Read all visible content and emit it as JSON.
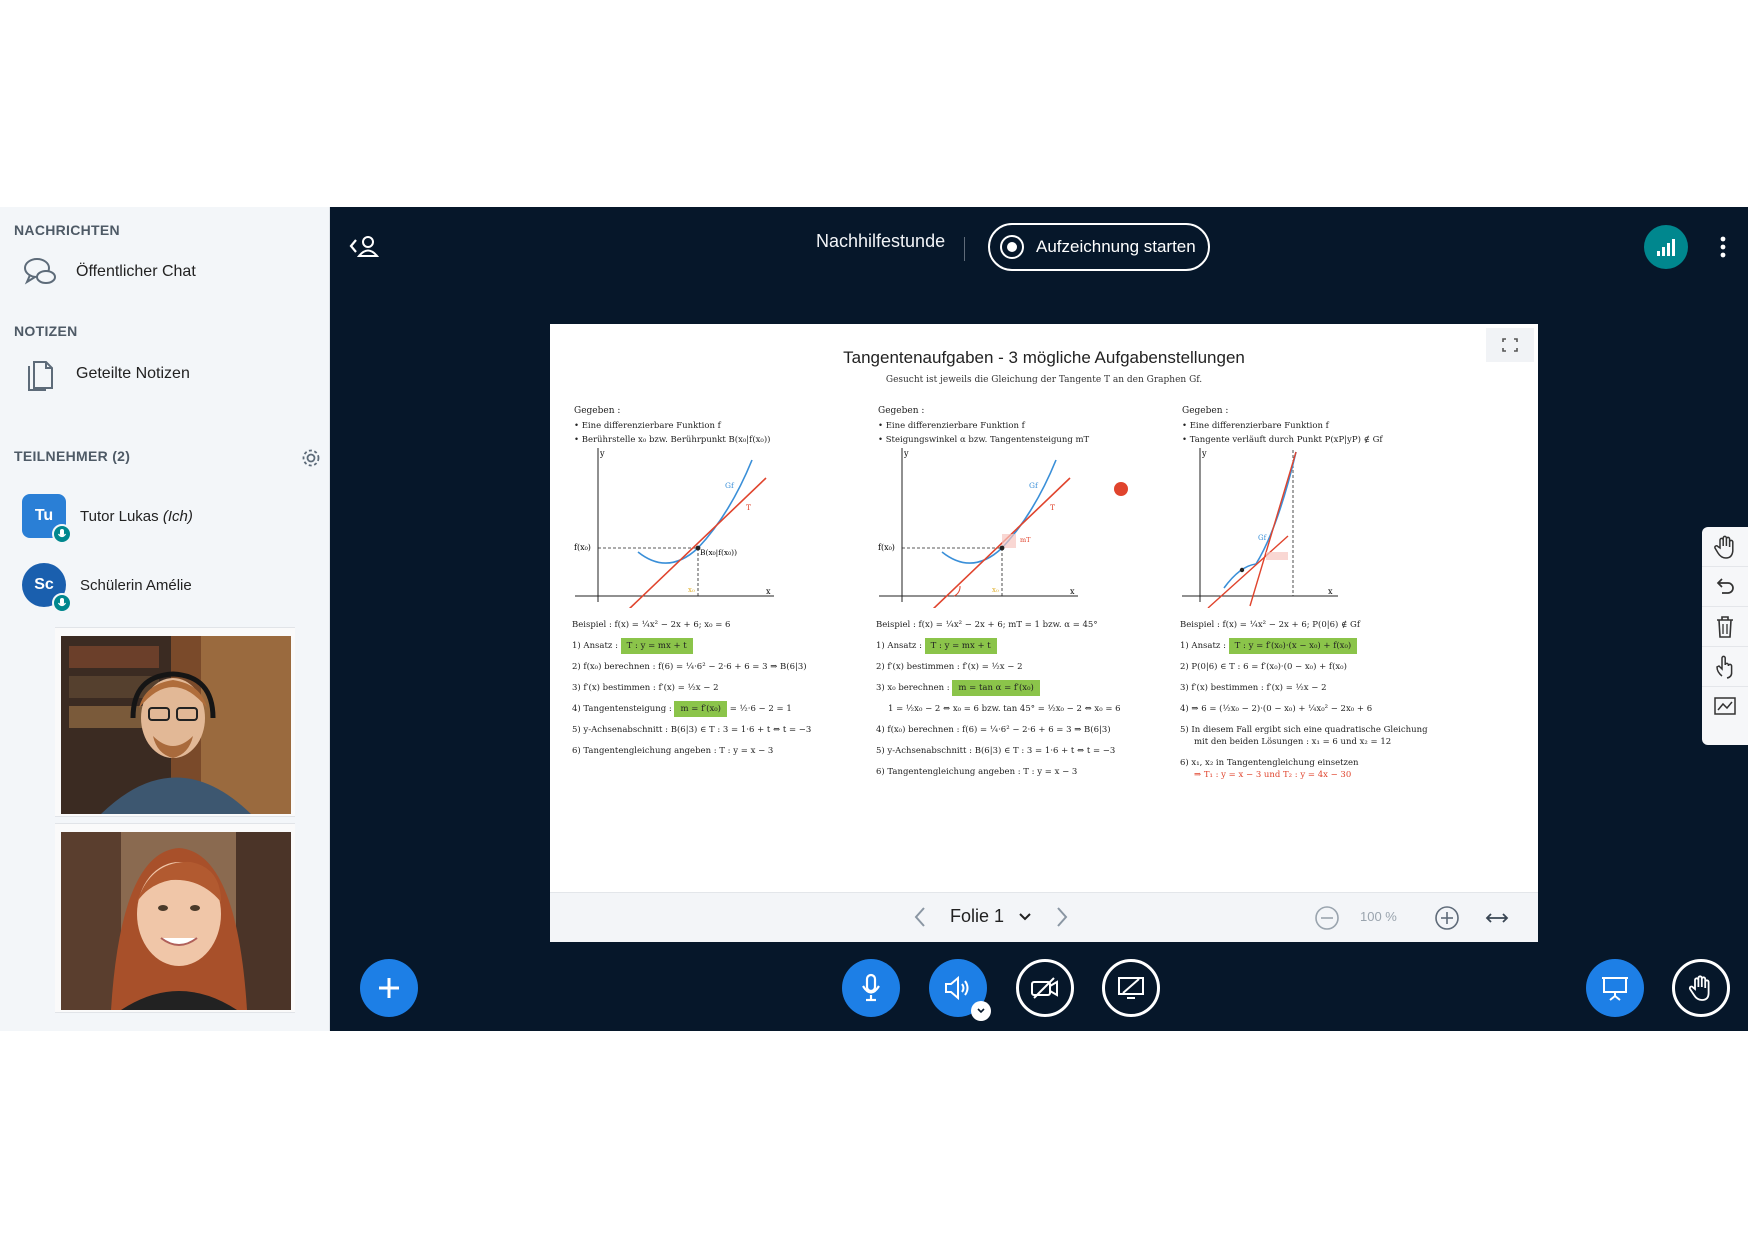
{
  "sidebar": {
    "messages_title": "NACHRICHTEN",
    "public_chat": "Öffentlicher Chat",
    "notes_title": "NOTIZEN",
    "shared_notes": "Geteilte Notizen",
    "participants_title": "TEILNEHMER (2)",
    "users": [
      {
        "initials": "Tu",
        "name": "Tutor Lukas",
        "suffix": "(Ich)"
      },
      {
        "initials": "Sc",
        "name": "Schülerin Amélie",
        "suffix": ""
      }
    ]
  },
  "header": {
    "meeting_title": "Nachhilfestunde",
    "record_label": "Aufzeichnung starten"
  },
  "slide": {
    "title": "Tangentenaufgaben - 3 mögliche Aufgabenstellungen",
    "subtitle": "Gesucht ist jeweils die Gleichung der Tangente T an den Graphen Gf.",
    "columns": [
      {
        "given": "Gegeben :",
        "bullets": [
          "• Eine differenzierbare Funktion f",
          "• Berührstelle x₀ bzw. Berührpunkt B(x₀|f(x₀))"
        ],
        "example": "Beispiel : f(x) = ¼x² − 2x + 6; x₀ = 6",
        "steps": [
          "1) Ansatz :",
          "2) f(x₀) berechnen : f(6) = ¼·6² − 2·6 + 6 = 3 ⇒ B(6|3)",
          "3) f′(x) bestimmen : f′(x) = ½x − 2",
          "4) Tangentensteigung :",
          "5) y-Achsenabschnitt : B(6|3) ∈ T : 3 = 1·6 + t ⇔ t = −3",
          "6) Tangentengleichung angeben : T : y = x − 3"
        ],
        "ansatz": "T : y = mx + t",
        "steigung": "m = f′(x₀)",
        "steigung_rest": "= ½·6 − 2 = 1"
      },
      {
        "given": "Gegeben :",
        "bullets": [
          "• Eine differenzierbare Funktion f",
          "• Steigungswinkel α bzw. Tangentensteigung mT"
        ],
        "example": "Beispiel : f(x) = ¼x² − 2x + 6; mT = 1 bzw. α = 45°",
        "steps": [
          "1) Ansatz :",
          "2) f′(x) bestimmen : f′(x) = ½x − 2",
          "3) x₀ berechnen :",
          "1 = ½x₀ − 2 ⇔ x₀ = 6 bzw. tan 45° = ½x₀ − 2 ⇔ x₀ = 6",
          "4) f(x₀) berechnen : f(6) = ¼·6² − 2·6 + 6 = 3 ⇒ B(6|3)",
          "5) y-Achsenabschnitt : B(6|3) ∈ T : 3 = 1·6 + t ⇔ t = −3",
          "6) Tangentengleichung angeben : T : y = x − 3"
        ],
        "ansatz": "T : y = mx + t",
        "x0": "m = tan α = f′(x₀)"
      },
      {
        "given": "Gegeben :",
        "bullets": [
          "• Eine differenzierbare Funktion f",
          "• Tangente verläuft durch Punkt P(xP|yP) ∉ Gf"
        ],
        "example": "Beispiel : f(x) = ¼x² − 2x + 6; P(0|6) ∉ Gf",
        "steps": [
          "1) Ansatz :",
          "2) P(0|6) ∈ T : 6 = f′(x₀)·(0 − x₀) + f(x₀)",
          "3) f′(x) bestimmen : f′(x) = ½x − 2",
          "4) ⇒ 6 = (½x₀ − 2)·(0 − x₀) + ¼x₀² − 2x₀ + 6",
          "5) In diesem Fall ergibt sich eine quadratische Gleichung",
          "mit den beiden Lösungen : x₁ = 6 und x₂ = 12",
          "6) x₁, x₂ in Tangentengleichung einsetzen",
          "⇒ T₁ : y = x − 3 und T₂ : y = 4x − 30"
        ],
        "ansatz": "T : y = f′(x₀)·(x − x₀) + f(x₀)"
      }
    ],
    "graph_labels": {
      "gf": "Gf",
      "t": "T",
      "y": "y",
      "x": "x",
      "fx0": "f(x₀)",
      "b": "B(x₀|f(x₀))",
      "x0": "x₀",
      "mt": "mT"
    },
    "controls": {
      "page_label": "Folie 1",
      "zoom": "100 %"
    }
  },
  "colors": {
    "main_bg": "#06172a",
    "accent_blue": "#1d7fe6",
    "teal": "#00878e",
    "highlight_green": "#8bc44a",
    "tangent_red": "#e0442d",
    "curve_blue": "#3a8fd8"
  },
  "icons": [
    "chat-icon",
    "notes-icon",
    "gear-icon",
    "user-toggle-icon",
    "signal-icon",
    "more-icon",
    "expand-icon",
    "hand-icon",
    "undo-icon",
    "trash-icon",
    "pointer-icon",
    "whiteboard-icon",
    "plus-icon",
    "mic-icon",
    "speaker-icon",
    "camera-off-icon",
    "screenshare-off-icon",
    "presentation-icon",
    "raise-hand-icon"
  ]
}
